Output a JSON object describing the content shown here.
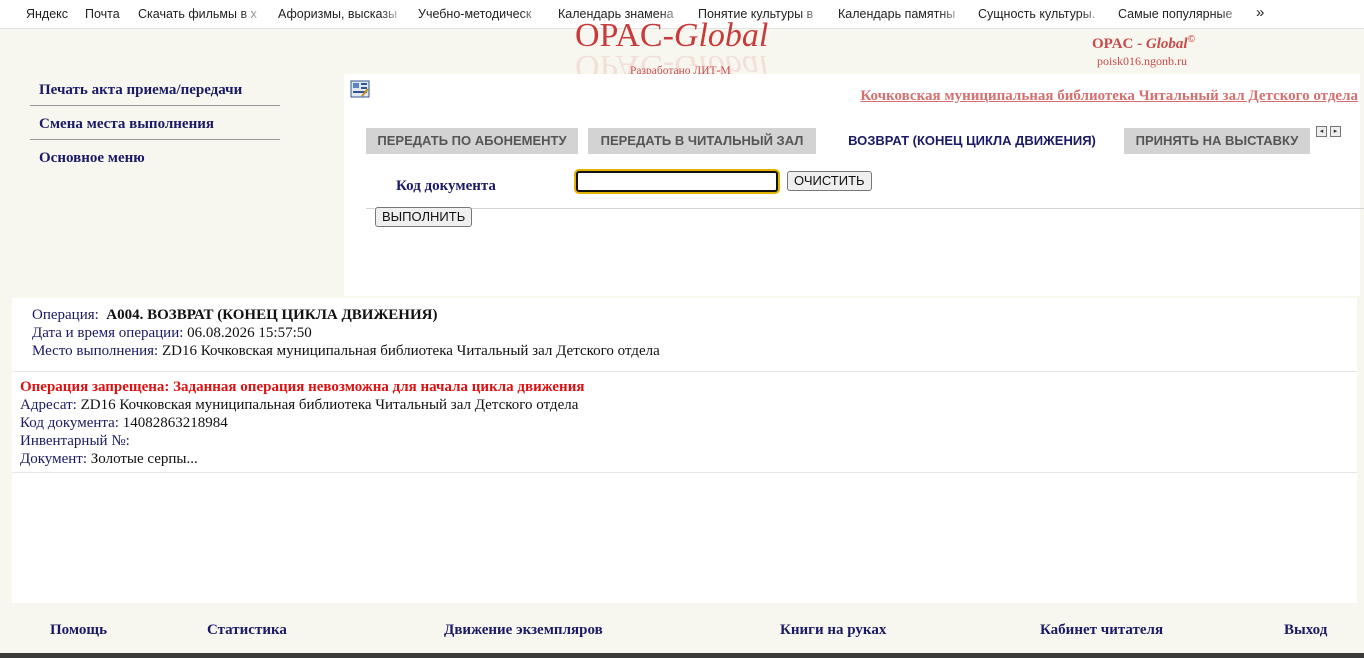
{
  "bookmarks": {
    "items": [
      "Яндекс",
      "Почта",
      "Скачать фильмы в х",
      "Афоризмы, высказы",
      "Учебно-методическ",
      "Календарь знамена",
      "Понятие культуры в",
      "Календарь памятны",
      "Сущность культуры.",
      "Самые популярные"
    ],
    "more": "»"
  },
  "logo": {
    "opac": "OPAC-",
    "global": "Global",
    "subtitle": "Разработано ЛИТ-М"
  },
  "brand": {
    "opac": "OPAC -",
    "global": "Global",
    "copyright": "©",
    "host": "poisk016.ngonb.ru"
  },
  "sidemenu": {
    "items": [
      "Печать акта приема/передачи",
      "Смена места выполнения",
      "Основное меню"
    ]
  },
  "main": {
    "library_link": "Кочковская муниципальная библиотека Читальный зал Детского отдела",
    "tabs": [
      "ПЕРЕДАТЬ ПО АБОНЕМЕНТУ",
      "ПЕРЕДАТЬ В ЧИТАЛЬНЫЙ ЗАЛ",
      "ВОЗВРАТ (КОНЕЦ ЦИКЛА ДВИЖЕНИЯ)",
      "ПРИНЯТЬ НА ВЫСТАВКУ"
    ],
    "active_tab": "ВОЗВРАТ (КОНЕЦ ЦИКЛА ДВИЖЕНИЯ)",
    "tab_prev": "◂",
    "tab_next": "▸",
    "form": {
      "doc_code_label": "Код документа",
      "doc_code_value": "",
      "clear_label": "ОЧИСТИТЬ",
      "execute_label": "ВЫПОЛНИТЬ"
    }
  },
  "operation": {
    "op_label": "Операция:",
    "op_value": "А004. ВОЗВРАТ (КОНЕЦ ЦИКЛА ДВИЖЕНИЯ)",
    "datetime_label": "Дата и время операции:",
    "datetime_value": "06.08.2026 15:57:50",
    "place_label": "Место выполнения:",
    "place_value": "ZD16 Кочковская муниципальная библиотека Читальный зал Детского отдела"
  },
  "result": {
    "error": "Операция запрещена: Заданная операция невозможна для начала цикла движения",
    "address_label": "Адресат:",
    "address_value": "ZD16 Кочковская муниципальная библиотека Читальный зал Детского отдела",
    "code_label": "Код документа:",
    "code_value": "14082863218984",
    "inventory_label": "Инвентарный №:",
    "inventory_value": "",
    "document_label": "Документ:",
    "document_value": "Золотые серпы..."
  },
  "footer": {
    "help": "Помощь",
    "stats": "Статистика",
    "movement": "Движение экземпляров",
    "books": "Книги на руках",
    "cabinet": "Кабинет читателя",
    "exit": "Выход"
  }
}
